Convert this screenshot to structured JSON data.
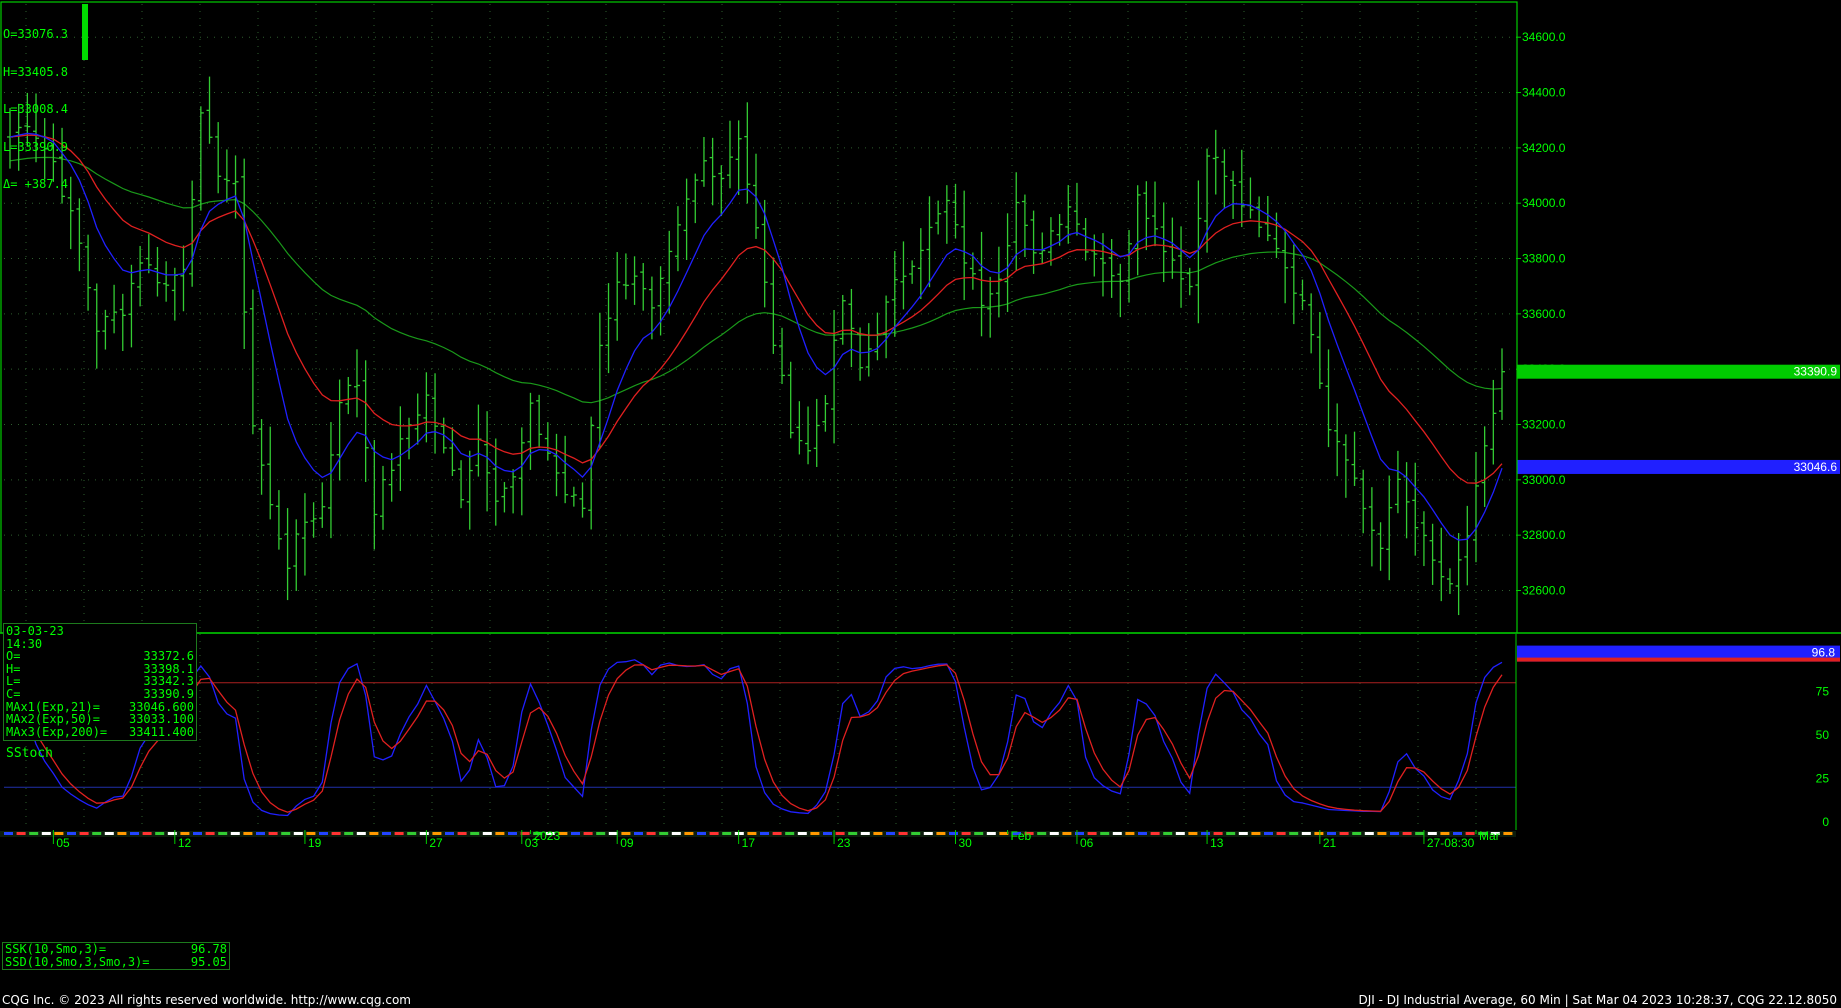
{
  "header_ohlc": {
    "open": "O=33076.3",
    "high": "H=33405.8",
    "low": "L=33008.4",
    "last": "L=33390.9",
    "delta": "Δ= +387.4"
  },
  "info_box": {
    "date": "03-03-23",
    "time": "14:30",
    "rows": [
      {
        "label": "O=",
        "value": "33372.6"
      },
      {
        "label": "H=",
        "value": "33398.1"
      },
      {
        "label": "L=",
        "value": "33342.3"
      },
      {
        "label": "C=",
        "value": "33390.9"
      },
      {
        "label": "MAx1(Exp,21)=",
        "value": "33046.600"
      },
      {
        "label": "MAx2(Exp,50)=",
        "value": "33033.100"
      },
      {
        "label": "MAx3(Exp,200)=",
        "value": "33411.400"
      }
    ]
  },
  "stoch_box": {
    "rows": [
      {
        "label": "SSK(10,Smo,3)=",
        "value": "96.78"
      },
      {
        "label": "SSD(10,Smo,3,Smo,3)=",
        "value": "95.05"
      }
    ]
  },
  "stoch_title": "SStoch",
  "footer": {
    "left": "CQG Inc. © 2023 All rights reserved worldwide. http://www.cqg.com",
    "right": "DJI - DJ Industrial Average, 60 Min | Sat Mar 04 2023 10:28:37, CQG 22.12.8050"
  },
  "colors": {
    "background": "#000000",
    "bars": "#33cc33",
    "ma21": "#2020ff",
    "ma50": "#e02020",
    "ma200": "#1a9a1a",
    "grid": "#2e5e2e",
    "axis_text": "#00ff00"
  },
  "chart_data": [
    {
      "type": "ohlc",
      "title": "DJI - DJ Industrial Average, 60 Min",
      "y_ticks": [
        32600,
        32800,
        33000,
        33200,
        33400,
        33600,
        33800,
        34000,
        34200,
        34400,
        34600
      ],
      "ylim": [
        32450,
        34720
      ],
      "x_labels": [
        {
          "label": "05",
          "idx": 5
        },
        {
          "label": "12",
          "idx": 19
        },
        {
          "label": "19",
          "idx": 34
        },
        {
          "label": "27",
          "idx": 48
        },
        {
          "label": "2023",
          "idx": 60,
          "row": "top"
        },
        {
          "label": "03",
          "idx": 59
        },
        {
          "label": "09",
          "idx": 70
        },
        {
          "label": "17",
          "idx": 84
        },
        {
          "label": "23",
          "idx": 95
        },
        {
          "label": "30",
          "idx": 109
        },
        {
          "label": "Feb",
          "idx": 115,
          "row": "top"
        },
        {
          "label": "06",
          "idx": 123
        },
        {
          "label": "13",
          "idx": 138
        },
        {
          "label": "21",
          "idx": 151
        },
        {
          "label": "27-08:30",
          "idx": 163
        },
        {
          "label": "Mar",
          "idx": 169,
          "row": "top"
        }
      ],
      "close_anchors": [
        [
          0,
          34240
        ],
        [
          2,
          34300
        ],
        [
          5,
          34150
        ],
        [
          8,
          33850
        ],
        [
          10,
          33550
        ],
        [
          13,
          33620
        ],
        [
          15,
          33800
        ],
        [
          18,
          33700
        ],
        [
          20,
          33780
        ],
        [
          22,
          34300
        ],
        [
          24,
          34120
        ],
        [
          26,
          34050
        ],
        [
          28,
          33200
        ],
        [
          30,
          32900
        ],
        [
          32,
          32700
        ],
        [
          34,
          32850
        ],
        [
          36,
          32900
        ],
        [
          38,
          33300
        ],
        [
          40,
          33350
        ],
        [
          42,
          32900
        ],
        [
          44,
          33050
        ],
        [
          46,
          33200
        ],
        [
          48,
          33300
        ],
        [
          50,
          33100
        ],
        [
          52,
          32950
        ],
        [
          54,
          33150
        ],
        [
          56,
          32950
        ],
        [
          58,
          33000
        ],
        [
          60,
          33250
        ],
        [
          62,
          33100
        ],
        [
          64,
          32950
        ],
        [
          66,
          32900
        ],
        [
          68,
          33500
        ],
        [
          70,
          33700
        ],
        [
          72,
          33750
        ],
        [
          74,
          33600
        ],
        [
          76,
          33800
        ],
        [
          78,
          34000
        ],
        [
          80,
          34150
        ],
        [
          82,
          34100
        ],
        [
          84,
          34250
        ],
        [
          86,
          33900
        ],
        [
          88,
          33500
        ],
        [
          90,
          33200
        ],
        [
          92,
          33100
        ],
        [
          94,
          33300
        ],
        [
          96,
          33650
        ],
        [
          98,
          33400
        ],
        [
          100,
          33550
        ],
        [
          102,
          33700
        ],
        [
          104,
          33800
        ],
        [
          106,
          33900
        ],
        [
          108,
          34000
        ],
        [
          110,
          33800
        ],
        [
          112,
          33650
        ],
        [
          114,
          33750
        ],
        [
          116,
          34000
        ],
        [
          118,
          33800
        ],
        [
          120,
          33900
        ],
        [
          122,
          34000
        ],
        [
          124,
          33850
        ],
        [
          126,
          33800
        ],
        [
          128,
          33700
        ],
        [
          130,
          34050
        ],
        [
          132,
          33900
        ],
        [
          134,
          33800
        ],
        [
          136,
          33700
        ],
        [
          138,
          34200
        ],
        [
          140,
          34100
        ],
        [
          142,
          34000
        ],
        [
          144,
          33900
        ],
        [
          146,
          33850
        ],
        [
          148,
          33700
        ],
        [
          150,
          33550
        ],
        [
          152,
          33200
        ],
        [
          154,
          33100
        ],
        [
          156,
          32900
        ],
        [
          158,
          32750
        ],
        [
          160,
          33000
        ],
        [
          162,
          32850
        ],
        [
          164,
          32700
        ],
        [
          166,
          32600
        ],
        [
          168,
          32800
        ],
        [
          170,
          33100
        ],
        [
          172,
          33390.9
        ]
      ],
      "last_price": 33390.9,
      "ma_values": {
        "ma21": 33046.6,
        "ma50": 33033.1,
        "ma200": 33411.4
      },
      "price_labels": [
        {
          "text": "33390.9",
          "value": 33390.9,
          "color": "#00cc00"
        },
        {
          "text": "33046.6",
          "value": 33046.6,
          "color": "#2020ff"
        }
      ]
    },
    {
      "type": "line",
      "title": "SStoch",
      "y_ticks": [
        0,
        25,
        50,
        75
      ],
      "ylim": [
        0,
        100
      ],
      "reference_lines": [
        {
          "value": 80,
          "color": "#aa2020"
        },
        {
          "value": 20,
          "color": "#2030aa"
        }
      ],
      "series": [
        {
          "name": "SSK(10,Smo,3)",
          "color": "#2020ff"
        },
        {
          "name": "SSD(10,Smo,3,Smo,3)",
          "color": "#e02020"
        }
      ],
      "last_label": {
        "text": "96.8",
        "value": 96.78
      }
    }
  ]
}
